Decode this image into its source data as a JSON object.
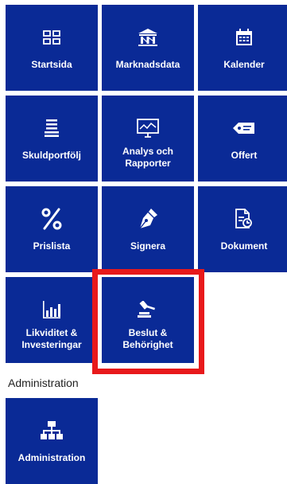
{
  "colors": {
    "tile_bg": "#0a2a96",
    "tile_text": "#ffffff",
    "highlight": "#e8191b"
  },
  "tiles": [
    {
      "label": "Startsida",
      "icon": "dashboard-grid-icon"
    },
    {
      "label": "Marknadsdata",
      "icon": "bank-building-icon"
    },
    {
      "label": "Kalender",
      "icon": "calendar-icon"
    },
    {
      "label": "Skuldportfölj",
      "icon": "stacked-layers-icon"
    },
    {
      "label_line1": "Analys och",
      "label_line2": "Rapporter",
      "icon": "monitor-chart-icon"
    },
    {
      "label": "Offert",
      "icon": "price-tag-icon"
    },
    {
      "label": "Prislista",
      "icon": "percent-icon"
    },
    {
      "label": "Signera",
      "icon": "pen-nib-icon"
    },
    {
      "label": "Dokument",
      "icon": "document-icon"
    },
    {
      "label_line1": "Likviditet &",
      "label_line2": "Investeringar",
      "icon": "bar-chart-icon"
    },
    {
      "label_line1": "Beslut &",
      "label_line2": "Behörighet",
      "icon": "gavel-icon"
    }
  ],
  "admin_section": {
    "heading": "Administration",
    "tile": {
      "label": "Administration",
      "icon": "org-chart-icon"
    }
  }
}
